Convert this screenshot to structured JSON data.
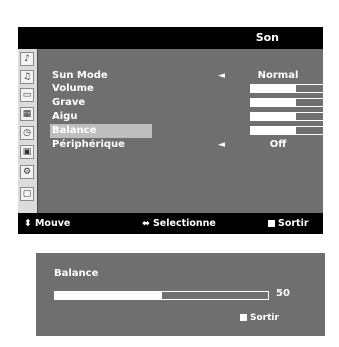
{
  "osd": {
    "title": "Son",
    "icons": [
      "speaker-icon",
      "note-icon",
      "tv-icon",
      "picture-icon",
      "clock-icon",
      "lock-icon",
      "settings-icon",
      "info-icon"
    ],
    "items": [
      {
        "label": "Sun Mode",
        "type": "choice",
        "value": "Normal"
      },
      {
        "label": "Volume",
        "type": "bar",
        "level": 0.5
      },
      {
        "label": "Grave",
        "type": "bar",
        "level": 0.5
      },
      {
        "label": "Aigu",
        "type": "bar",
        "level": 0.5
      },
      {
        "label": "Balance",
        "type": "bar",
        "level": 0.5,
        "selected": true
      },
      {
        "label": "Périphérique",
        "type": "choice",
        "value": "Off"
      }
    ],
    "footer": {
      "move_label": "Mouve",
      "select_label": "Selectionne",
      "exit_label": "Sortir"
    }
  },
  "balance_panel": {
    "title": "Balance",
    "value": "50",
    "level": 0.5,
    "exit_label": "Sortir"
  }
}
